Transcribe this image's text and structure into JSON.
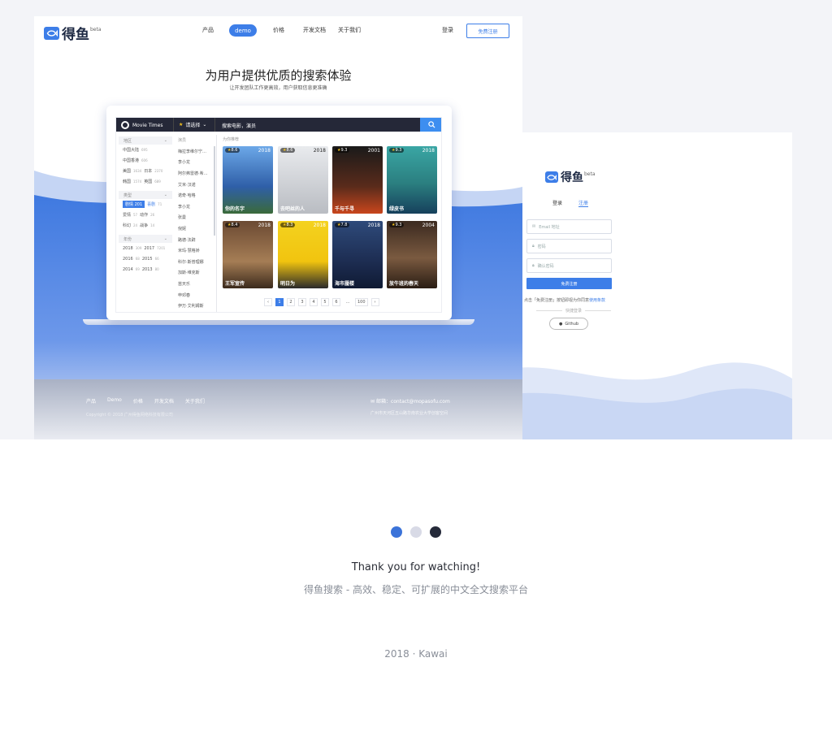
{
  "login_panel": {
    "logo": "得鱼",
    "beta": "beta",
    "tabs": [
      "登录",
      "注册"
    ],
    "email_placeholder": "Email 地址",
    "password_placeholder": "密码",
    "confirm_placeholder": "确认密码",
    "register_button": "免费注册",
    "agree_text": "点击「免费注册」按钮即视为你同意",
    "terms_link": "使用条款",
    "quick_login": "快捷登录",
    "github_button": "Github"
  },
  "site": {
    "logo": "得鱼",
    "beta": "beta",
    "nav": [
      "产品",
      "demo",
      "价格",
      "开发文档",
      "关于我们"
    ],
    "login": "登录",
    "register": "免费注册",
    "hero_title": "为用户提供优质的搜索体验",
    "hero_subtitle": "让开发团队工作更高效，用户获取信息更准确"
  },
  "app": {
    "brand": "Movie Times",
    "selector": "请选择",
    "search_text": "搜索电影，演员",
    "region_header": "地区",
    "regions": [
      [
        "中国大陆",
        "695",
        "",
        ""
      ],
      [
        "中国香港",
        "606",
        "",
        ""
      ],
      [
        "美国",
        "1634",
        "日本",
        "2370"
      ],
      [
        "韩国",
        "1574",
        "英国",
        "689"
      ]
    ],
    "type_header": "类型",
    "types": [
      [
        "剧情",
        "201",
        "喜剧",
        "71"
      ],
      [
        "爱情",
        "57",
        "动作",
        "26"
      ],
      [
        "科幻",
        "24",
        "战争",
        "14"
      ]
    ],
    "year_header": "年份",
    "years": [
      [
        "2018",
        "309",
        "2017",
        "7201"
      ],
      [
        "2016",
        "68",
        "2015",
        "66"
      ],
      [
        "2014",
        "69",
        "2013",
        "80"
      ]
    ],
    "people_header": "演员",
    "people": [
      "梅拉李维尔宁…",
      "李小龙",
      "阿尔弗雷德·希…",
      "艾米·汉诺",
      "诺奇·哈格",
      "李小龙",
      "张曼",
      "倪妮",
      "路德·法辟",
      "米玛·慧格娇",
      "科尔·斯普理娜",
      "加斯·维克斯",
      "苗天乐",
      "申邓春",
      "伊万·艾利姆斯"
    ],
    "grid_header": "为你推荐",
    "movies": [
      {
        "title": "你的名字",
        "rating": "8.6",
        "year": "2018"
      },
      {
        "title": "去吧丝的人",
        "rating": "8.6",
        "year": "2018"
      },
      {
        "title": "千与千寻",
        "rating": "9.3",
        "year": "2001"
      },
      {
        "title": "绿皮书",
        "rating": "9.3",
        "year": "2018"
      },
      {
        "title": "王军宣传",
        "rating": "8.4",
        "year": "2018"
      },
      {
        "title": "明日为",
        "rating": "8.3",
        "year": "2018"
      },
      {
        "title": "海市蜃楼",
        "rating": "7.8",
        "year": "2018"
      },
      {
        "title": "放牛班的春天",
        "rating": "9.3",
        "year": "2004"
      }
    ],
    "pages": [
      "‹",
      "1",
      "2",
      "3",
      "4",
      "5",
      "6",
      "…",
      "100",
      "›"
    ]
  },
  "footer": {
    "links": [
      "产品",
      "Demo",
      "价格",
      "开发文档",
      "关于我们"
    ],
    "email": "邮箱：contact@mopasofu.com",
    "address": "广州市天河区五山路华南农业大学创客空间",
    "copyright": "Copyright © 2018 广州得鱼网络科技有限公司"
  },
  "closing": {
    "thanks": "Thank you for watching!",
    "tagline": "得鱼搜索 - 高效、稳定、可扩展的中文全文搜索平台",
    "credit": "2018 · Kawai"
  },
  "colors": {
    "dots": [
      "#3b73d9",
      "#d8dae6",
      "#252a3a"
    ]
  }
}
